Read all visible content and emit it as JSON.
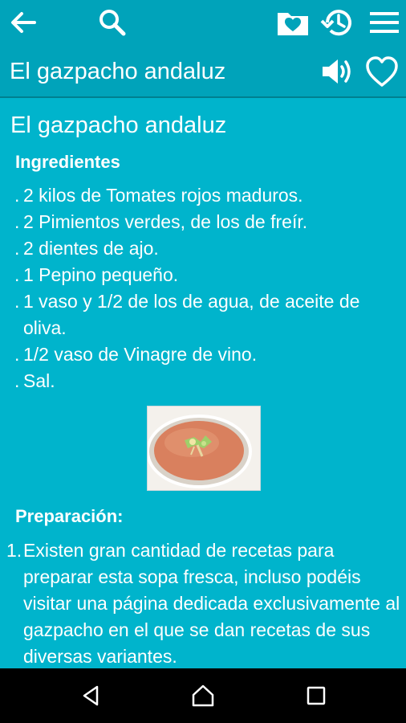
{
  "toolbar": {
    "back_icon": "arrow-left-icon",
    "search_icon": "search-icon",
    "favorites_icon": "folder-heart-icon",
    "history_icon": "history-icon",
    "menu_icon": "hamburger-menu-icon"
  },
  "header": {
    "title": "El gazpacho andaluz",
    "speak_icon": "speaker-icon",
    "favorite_icon": "heart-outline-icon"
  },
  "recipe": {
    "title": "El gazpacho andaluz",
    "ingredients_heading": "Ingredientes",
    "ingredients": [
      ".2 kilos de Tomates rojos maduros.",
      ".2 Pimientos verdes, de los de freír.",
      ".2 dientes de ajo.",
      ".1 Pepino pequeño.",
      ".1 vaso y 1/2 de los de agua, de aceite de oliva.",
      ".1/2 vaso de Vinagre de vino.",
      ".Sal."
    ],
    "photo_description": "gazpacho-bowl-photo",
    "preparation_heading": "Preparación:",
    "steps": [
      {
        "number": "1.",
        "text": "Existen gran cantidad de recetas para preparar esta sopa fresca, incluso podéis visitar una página dedicada exclusivamente al gazpacho en el que se dan recetas de sus diversas variantes."
      }
    ]
  },
  "navbar": {
    "back_icon": "nav-back-triangle-icon",
    "home_icon": "nav-home-icon",
    "recents_icon": "nav-recents-square-icon"
  },
  "colors": {
    "background": "#00b4cc",
    "toolbar": "#00a3ba",
    "text": "#ffffff",
    "navbar": "#000000"
  }
}
